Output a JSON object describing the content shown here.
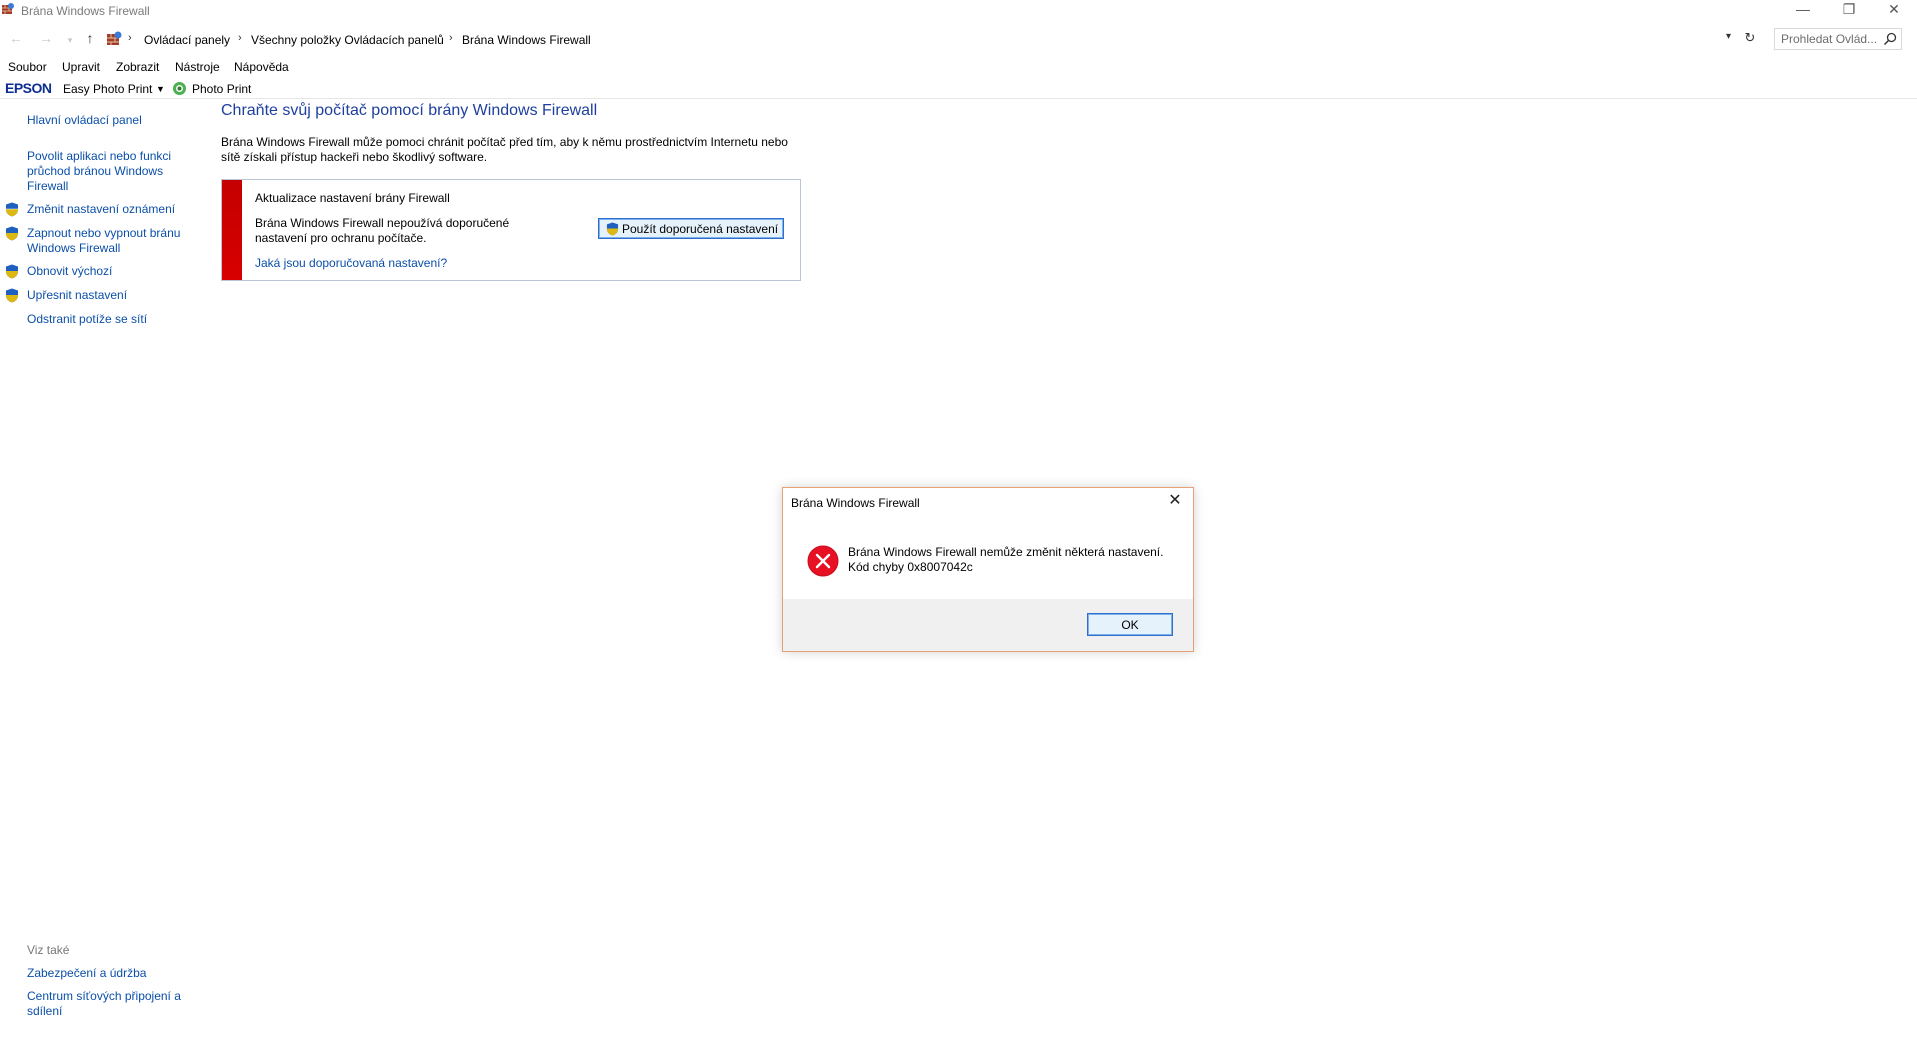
{
  "window": {
    "title": "Brána Windows Firewall",
    "minimize_glyph": "—",
    "restore_glyph": "❐",
    "close_glyph": "✕"
  },
  "address_bar": {
    "crumbs": [
      "Ovládací panely",
      "Všechny položky Ovládacích panelů",
      "Brána Windows Firewall"
    ],
    "search_placeholder": "Prohledat Ovlád..."
  },
  "menu": {
    "items": [
      "Soubor",
      "Upravit",
      "Zobrazit",
      "Nástroje",
      "Nápověda"
    ]
  },
  "toolbar": {
    "brand": "EPSON",
    "easy_photo_print": "Easy Photo Print",
    "photo_print": "Photo Print"
  },
  "sidebar": {
    "home_link": "Hlavní ovládací panel",
    "links": [
      {
        "label": "Povolit aplikaci nebo funkci průchod bránou Windows Firewall",
        "shield": false
      },
      {
        "label": "Změnit nastavení oznámení",
        "shield": true
      },
      {
        "label": "Zapnout nebo vypnout bránu Windows Firewall",
        "shield": true
      },
      {
        "label": "Obnovit výchozí",
        "shield": true
      },
      {
        "label": "Upřesnit nastavení",
        "shield": true
      },
      {
        "label": "Odstranit potíže se sítí",
        "shield": false
      }
    ],
    "see_also_title": "Viz také",
    "see_also": [
      "Zabezpečení a údržba",
      "Centrum síťových připojení a sdílení"
    ]
  },
  "main": {
    "title": "Chraňte svůj počítač pomocí brány Windows Firewall",
    "description": "Brána Windows Firewall může pomoci chránit počítač před tím, aby k němu prostřednictvím Internetu nebo sítě získali přístup hackeři nebo škodlivý software.",
    "panel": {
      "title": "Aktualizace nastavení brány Firewall",
      "text": "Brána Windows Firewall nepoužívá doporučené nastavení pro ochranu počítače.",
      "button": "Použít doporučená nastavení",
      "link": "Jaká jsou doporučovaná nastavení?"
    }
  },
  "dialog": {
    "title": "Brána Windows Firewall",
    "message_line1": "Brána Windows Firewall nemůže změnit některá nastavení.",
    "message_line2": "Kód chyby 0x8007042c",
    "ok_button": "OK"
  },
  "colors": {
    "link": "#0b4fa8",
    "heading": "#1e3f9e",
    "alert_red": "#d00000",
    "dialog_border": "#e6a077"
  }
}
